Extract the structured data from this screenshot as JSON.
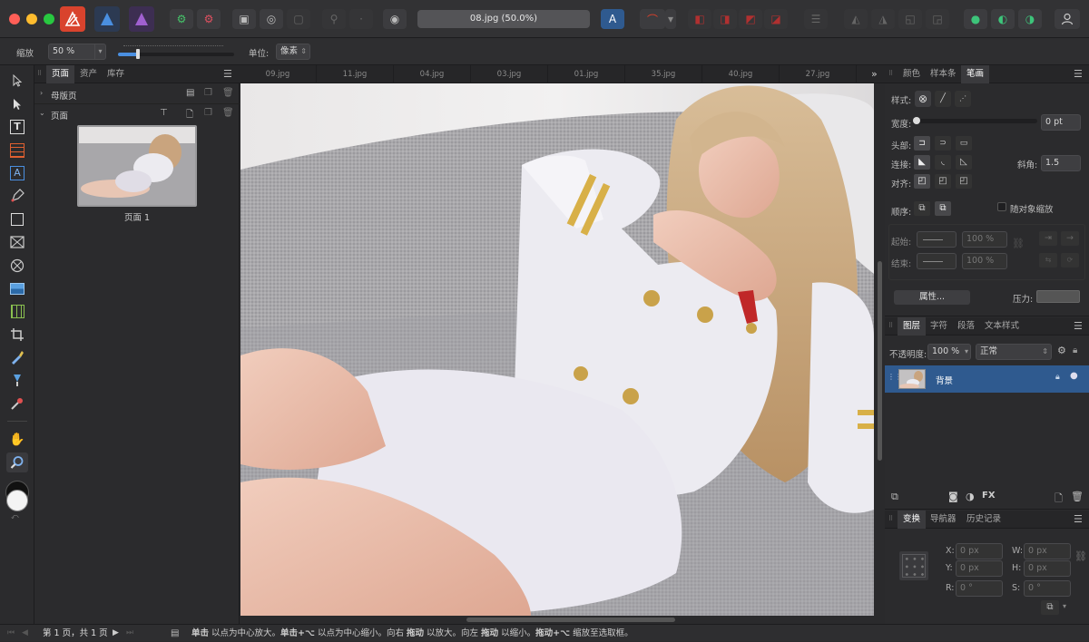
{
  "document": {
    "title": "08.jpg (50.0%)"
  },
  "context_bar": {
    "zoom_label": "缩放",
    "zoom_value": "50 %",
    "unit_label": "单位:",
    "unit_value": "像素"
  },
  "left_panel": {
    "tabs": [
      {
        "label": "页面"
      },
      {
        "label": "资产"
      },
      {
        "label": "库存"
      }
    ],
    "master_pages_label": "母版页",
    "pages_label": "页面",
    "page_thumb_label": "页面 1"
  },
  "doc_tabs": [
    "09.jpg",
    "11.jpg",
    "04.jpg",
    "03.jpg",
    "01.jpg",
    "35.jpg",
    "40.jpg",
    "27.jpg"
  ],
  "stroke_panel": {
    "tabs": [
      {
        "label": "颜色"
      },
      {
        "label": "样本条"
      },
      {
        "label": "笔画"
      }
    ],
    "style_label": "样式:",
    "width_label": "宽度:",
    "width_value": "0 pt",
    "cap_label": "头部:",
    "join_label": "连接:",
    "miter_label": "斜角:",
    "miter_value": "1.5",
    "align_label": "对齐:",
    "order_label": "顺序:",
    "scale_label": "随对象缩放",
    "start_label": "起始:",
    "start_pct": "100 %",
    "end_label": "结束:",
    "end_pct": "100 %",
    "props_button": "属性...",
    "pressure_label": "压力:"
  },
  "layers_panel": {
    "tabs": [
      {
        "label": "图层"
      },
      {
        "label": "字符"
      },
      {
        "label": "段落"
      },
      {
        "label": "文本样式"
      }
    ],
    "opacity_label": "不透明度:",
    "opacity_value": "100 %",
    "blend_mode": "正常",
    "layer_name": "背景"
  },
  "transform_panel": {
    "tabs": [
      {
        "label": "变换"
      },
      {
        "label": "导航器"
      },
      {
        "label": "历史记录"
      }
    ],
    "x_label": "X:",
    "x_value": "0 px",
    "y_label": "Y:",
    "y_value": "0 px",
    "w_label": "W:",
    "w_value": "0 px",
    "h_label": "H:",
    "h_value": "0 px",
    "r_label": "R:",
    "r_value": "0 °",
    "s_label": "S:",
    "s_value": "0 °"
  },
  "status": {
    "page_info": "第 1 页，共 1 页",
    "hint": {
      "b1": "单击",
      "t1": " 以点为中心放大。",
      "b2": "单击+⌥",
      "t2": " 以点为中心缩小。向右 ",
      "b3": "拖动",
      "t3": " 以放大。向左 ",
      "b4": "拖动",
      "t4": " 以缩小。",
      "b5": "拖动+⌥",
      "t5": " 缩放至选取框。"
    }
  },
  "colors": {
    "accent": "#2b5fa8",
    "selected_layer": "#2f5a8f",
    "app_red": "#e0402a"
  }
}
